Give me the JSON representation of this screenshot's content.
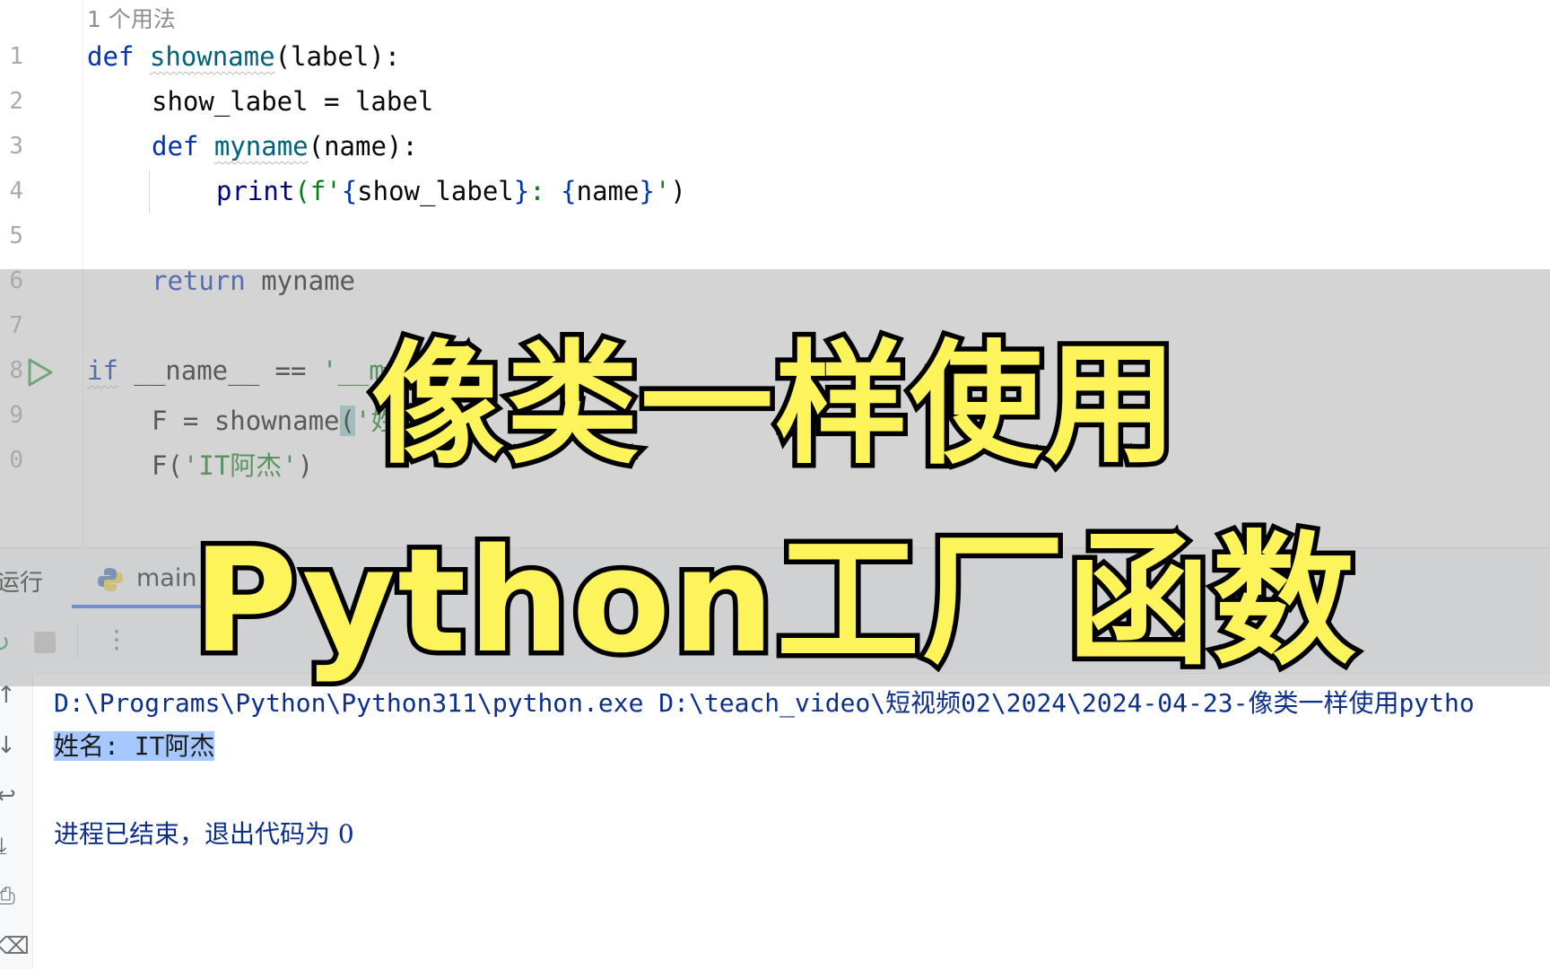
{
  "editor": {
    "usage_hint": "1 个用法",
    "line_numbers": [
      "1",
      "2",
      "3",
      "4",
      "5",
      "6",
      "7",
      "8",
      "9",
      "0"
    ],
    "line1": {
      "kw": "def",
      "fn": "showname",
      "rest": "(label):"
    },
    "line2": {
      "text": "show_label = label"
    },
    "line3": {
      "kw": "def",
      "fn": "myname",
      "rest": "(name):"
    },
    "line4": {
      "fn": "print",
      "open": "(f'",
      "brace_open": "{",
      "var1": "show_label",
      "brace_close": "}",
      "sep": ": ",
      "brace_open2": "{",
      "var2": "name",
      "brace_close2": "}",
      "close_str": "'",
      "close": ")"
    },
    "line6": {
      "kw": "return",
      "rest": " myname"
    },
    "line8": {
      "kw": "if",
      "rest": " __name__ == ",
      "str": "'__m"
    },
    "line9": {
      "rest": "F = showname",
      "paren": "(",
      "str": "'姓"
    },
    "line10": {
      "rest": "F(",
      "str": "'IT阿杰'",
      "close": ")"
    }
  },
  "run_panel": {
    "label": "运行",
    "tab_label": "main",
    "tab_close": "×",
    "rerun_icon": "rerun-icon",
    "stop_icon": "stop-icon",
    "more": "⋮"
  },
  "console": {
    "command": "D:\\Programs\\Python\\Python311\\python.exe D:\\teach_video\\短视频02\\2024\\2024-04-23-像类一样使用pytho",
    "output": "姓名: IT阿杰",
    "exit_message": "进程已结束，退出代码为 0"
  },
  "banner": {
    "title_line1": "像类一样使用",
    "title_line2": "Python工厂函数"
  },
  "colors": {
    "keyword": "#0033b3",
    "function": "#00627a",
    "string": "#067d17",
    "banner_text": "#fdf45c",
    "selection": "#a6c8ff"
  }
}
